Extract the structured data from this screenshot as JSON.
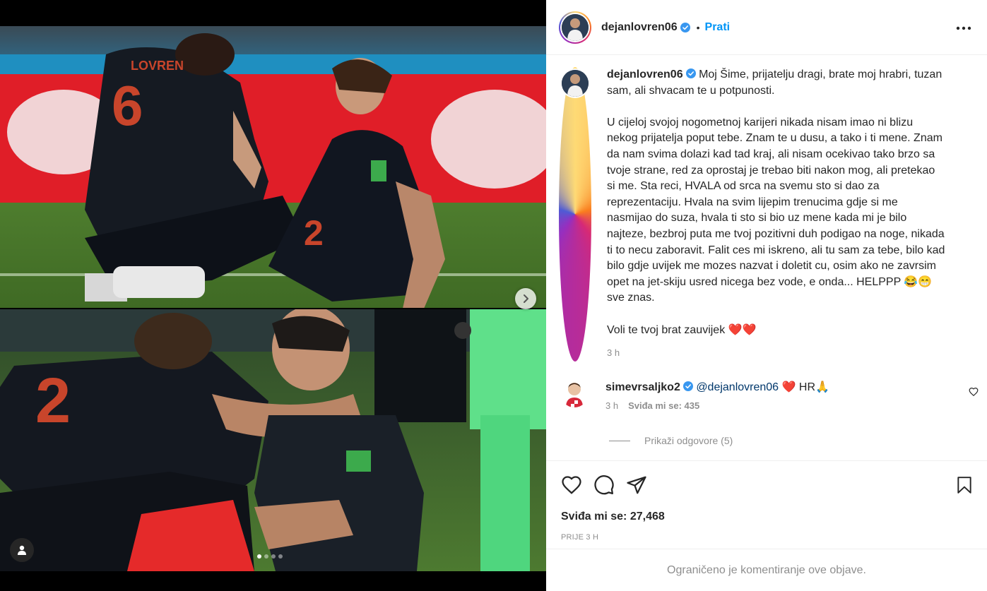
{
  "post": {
    "username": "dejanlovren06",
    "follow_label": "Prati",
    "separator": "•"
  },
  "caption": {
    "username": "dejanlovren06",
    "paragraph1": "Moj Šime, prijatelju dragi, brate moj hrabri, tuzan sam, ali shvacam te u potpunosti.",
    "paragraph2": "U cijeloj svojoj nogometnoj karijeri nikada nisam imao ni blizu nekog prijatelja poput tebe. Znam te u dusu, a tako i ti mene. Znam da nam svima dolazi kad tad kraj, ali nisam ocekivao tako brzo sa tvoje strane, red za oprostaj je trebao biti nakon mog, ali pretekao si me. Sta reci, HVALA od srca na svemu sto si dao za reprezentaciju. Hvala na svim lijepim trenucima gdje si me nasmijao do suza, hvala ti sto si bio uz mene kada mi je bilo najteze, bezbroj puta me tvoj pozitivni duh podigao na noge, nikada ti to necu zaboravit. Falit ces mi iskreno, ali tu sam za tebe, bilo kad bilo gdje uvijek me mozes nazvat i doletit cu, osim ako ne zavrsim opet na jet-skiju usred nicega bez vode, e onda... HELPPP 😂😁 sve znas.",
    "paragraph3": "Voli te tvoj brat zauvijek ❤️❤️",
    "time": "3 h"
  },
  "comment": {
    "username": "simevrsaljko2",
    "mention": "@dejanlovren06",
    "text": "❤️ HR🙏",
    "time": "3 h",
    "likes": "Sviđa mi se: 435"
  },
  "replies_label": "Prikaži odgovore (5)",
  "likes_label": "Sviđa mi se: 27,468",
  "posted_label": "PRIJE 3 H",
  "restricted_label": "Ograničeno je komentiranje ove objave.",
  "carousel": {
    "current": 1,
    "total": 4
  },
  "icons": {
    "more": "more-options-icon",
    "like": "heart-icon",
    "comment": "comment-icon",
    "share": "share-icon",
    "save": "bookmark-icon",
    "verified": "verified-badge-icon",
    "next": "chevron-right-icon",
    "tag": "user-tag-icon"
  },
  "colors": {
    "accent": "#0095f6",
    "verified": "#3897f0",
    "muted": "#8e8e8e",
    "mention": "#00376b"
  }
}
